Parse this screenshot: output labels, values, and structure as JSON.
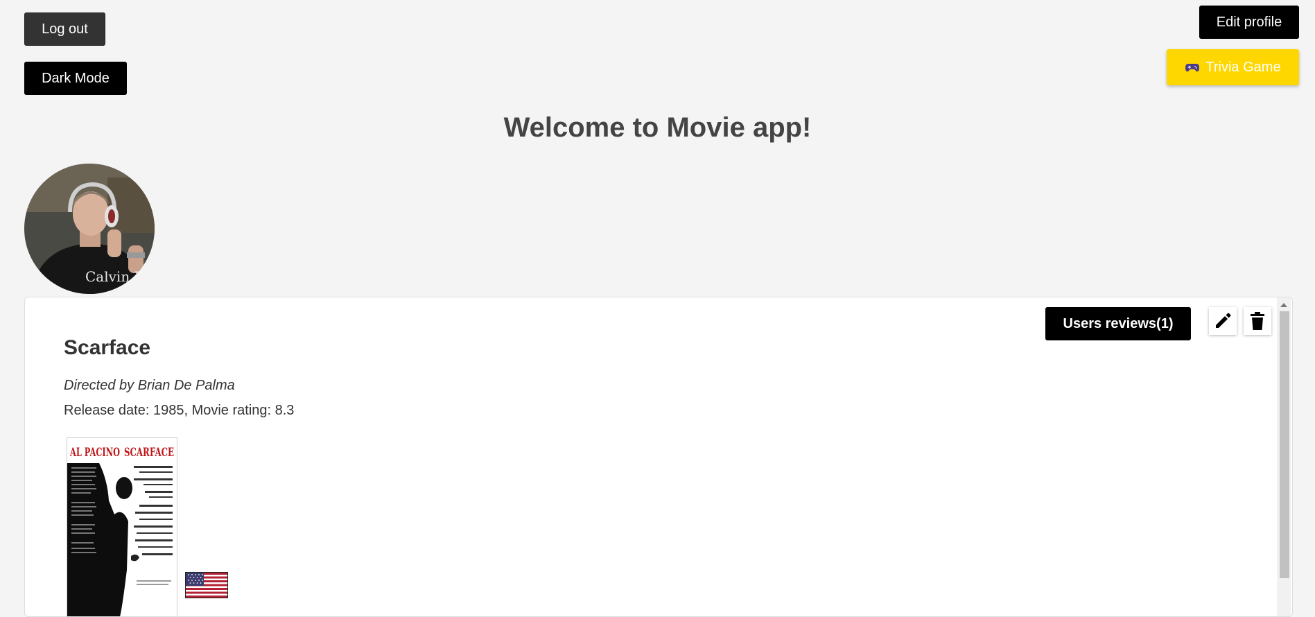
{
  "header": {
    "logout_label": "Log out",
    "darkmode_label": "Dark Mode",
    "edit_profile_label": "Edit profile",
    "trivia_label": "Trivia Game",
    "trivia_icon": "gamepad-icon"
  },
  "page_title": "Welcome to Movie app!",
  "avatar": {
    "icon": "user-avatar",
    "shirt_text": "Calvin Klein"
  },
  "movie": {
    "title": "Scarface",
    "director_line": "Directed by Brian De Palma",
    "release_line": "Release date: 1985, Movie rating: 8.3",
    "reviews_label": "Users reviews(1)",
    "edit_icon": "pencil-icon",
    "delete_icon": "trash-icon",
    "poster_text_left": "AL PACINO",
    "poster_text_right": "SCARFACE",
    "flag_icon": "us-flag-icon"
  },
  "colors": {
    "background": "#f4f4f4",
    "trivia": "#ffd700",
    "primary_button": "#000000"
  }
}
